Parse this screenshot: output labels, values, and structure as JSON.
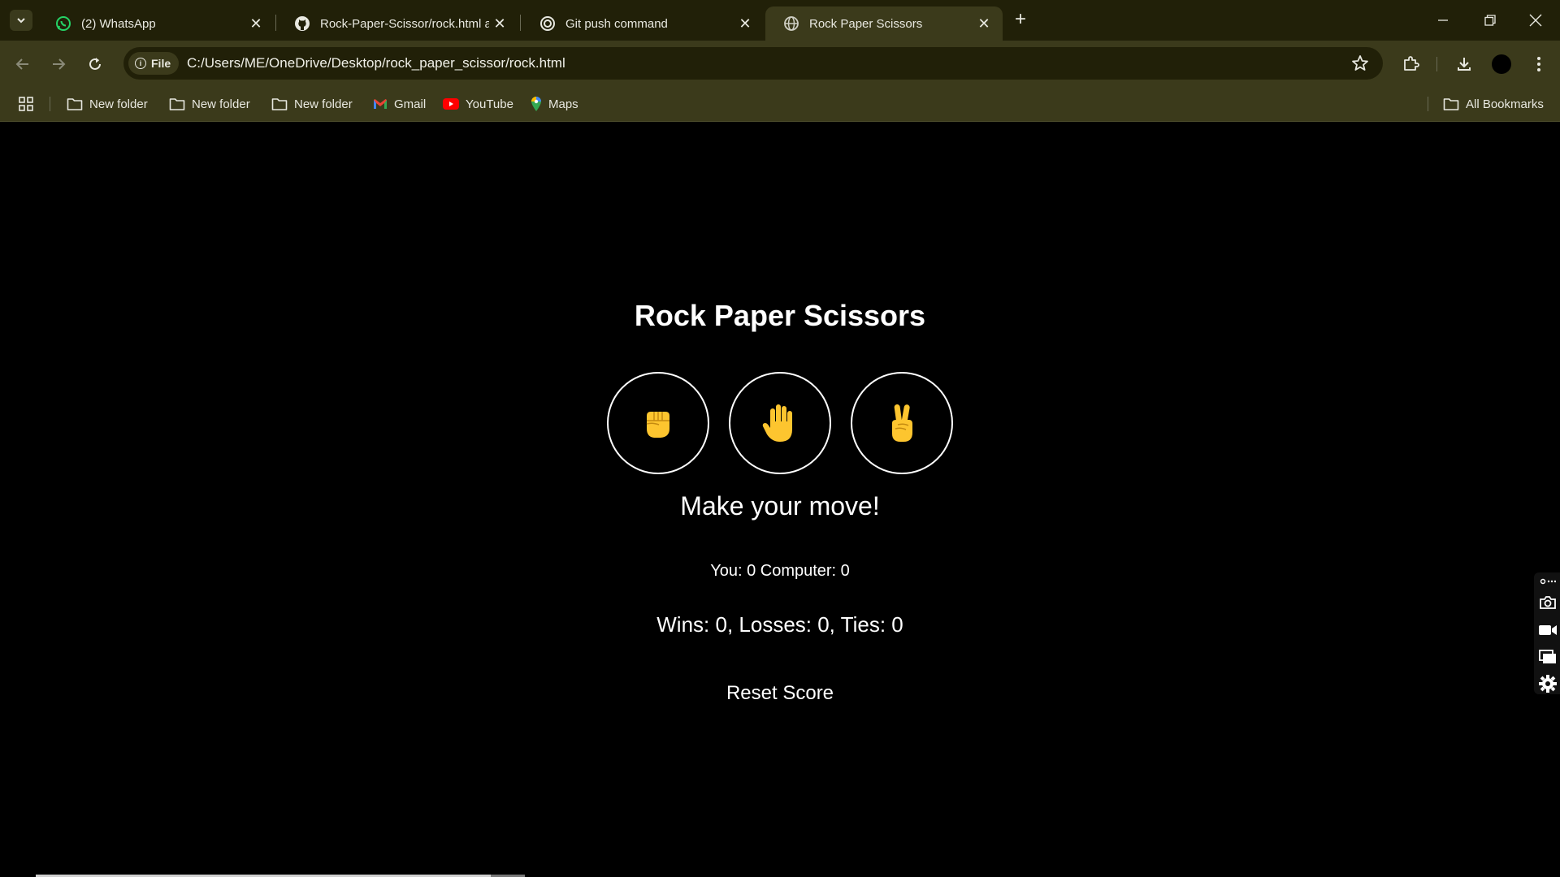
{
  "browser": {
    "tabs": [
      {
        "title": "(2) WhatsApp",
        "icon": "whatsapp-icon",
        "active": false
      },
      {
        "title": "Rock-Paper-Scissor/rock.html at",
        "icon": "github-icon",
        "active": false
      },
      {
        "title": "Git push command",
        "icon": "chatgpt-icon",
        "active": false
      },
      {
        "title": "Rock Paper Scissors",
        "icon": "globe-icon",
        "active": true
      }
    ],
    "address": {
      "scheme_chip": "File",
      "url": "C:/Users/ME/OneDrive/Desktop/rock_paper_scissor/rock.html"
    },
    "bookmarks": [
      {
        "label": "New folder",
        "icon": "folder-icon"
      },
      {
        "label": "New folder",
        "icon": "folder-icon"
      },
      {
        "label": "New folder",
        "icon": "folder-icon"
      },
      {
        "label": "Gmail",
        "icon": "gmail-icon"
      },
      {
        "label": "YouTube",
        "icon": "youtube-icon"
      },
      {
        "label": "Maps",
        "icon": "maps-icon"
      }
    ],
    "all_bookmarks": "All Bookmarks"
  },
  "game": {
    "title": "Rock Paper Scissors",
    "choices": [
      {
        "name": "rock",
        "icon": "raised-fist-icon"
      },
      {
        "name": "paper",
        "icon": "raised-hand-icon"
      },
      {
        "name": "scissors",
        "icon": "victory-hand-icon"
      }
    ],
    "message": "Make your move!",
    "score_line": "You: 0 Computer: 0",
    "tally_line": "Wins: 0, Losses: 0, Ties: 0",
    "reset_label": "Reset Score"
  },
  "colors": {
    "chrome_frame": "#212008",
    "chrome_toolbar": "#3b3a1b",
    "emoji_yellow": "#FDC52F",
    "page_background": "#000000",
    "page_text": "#FFFFFF"
  }
}
